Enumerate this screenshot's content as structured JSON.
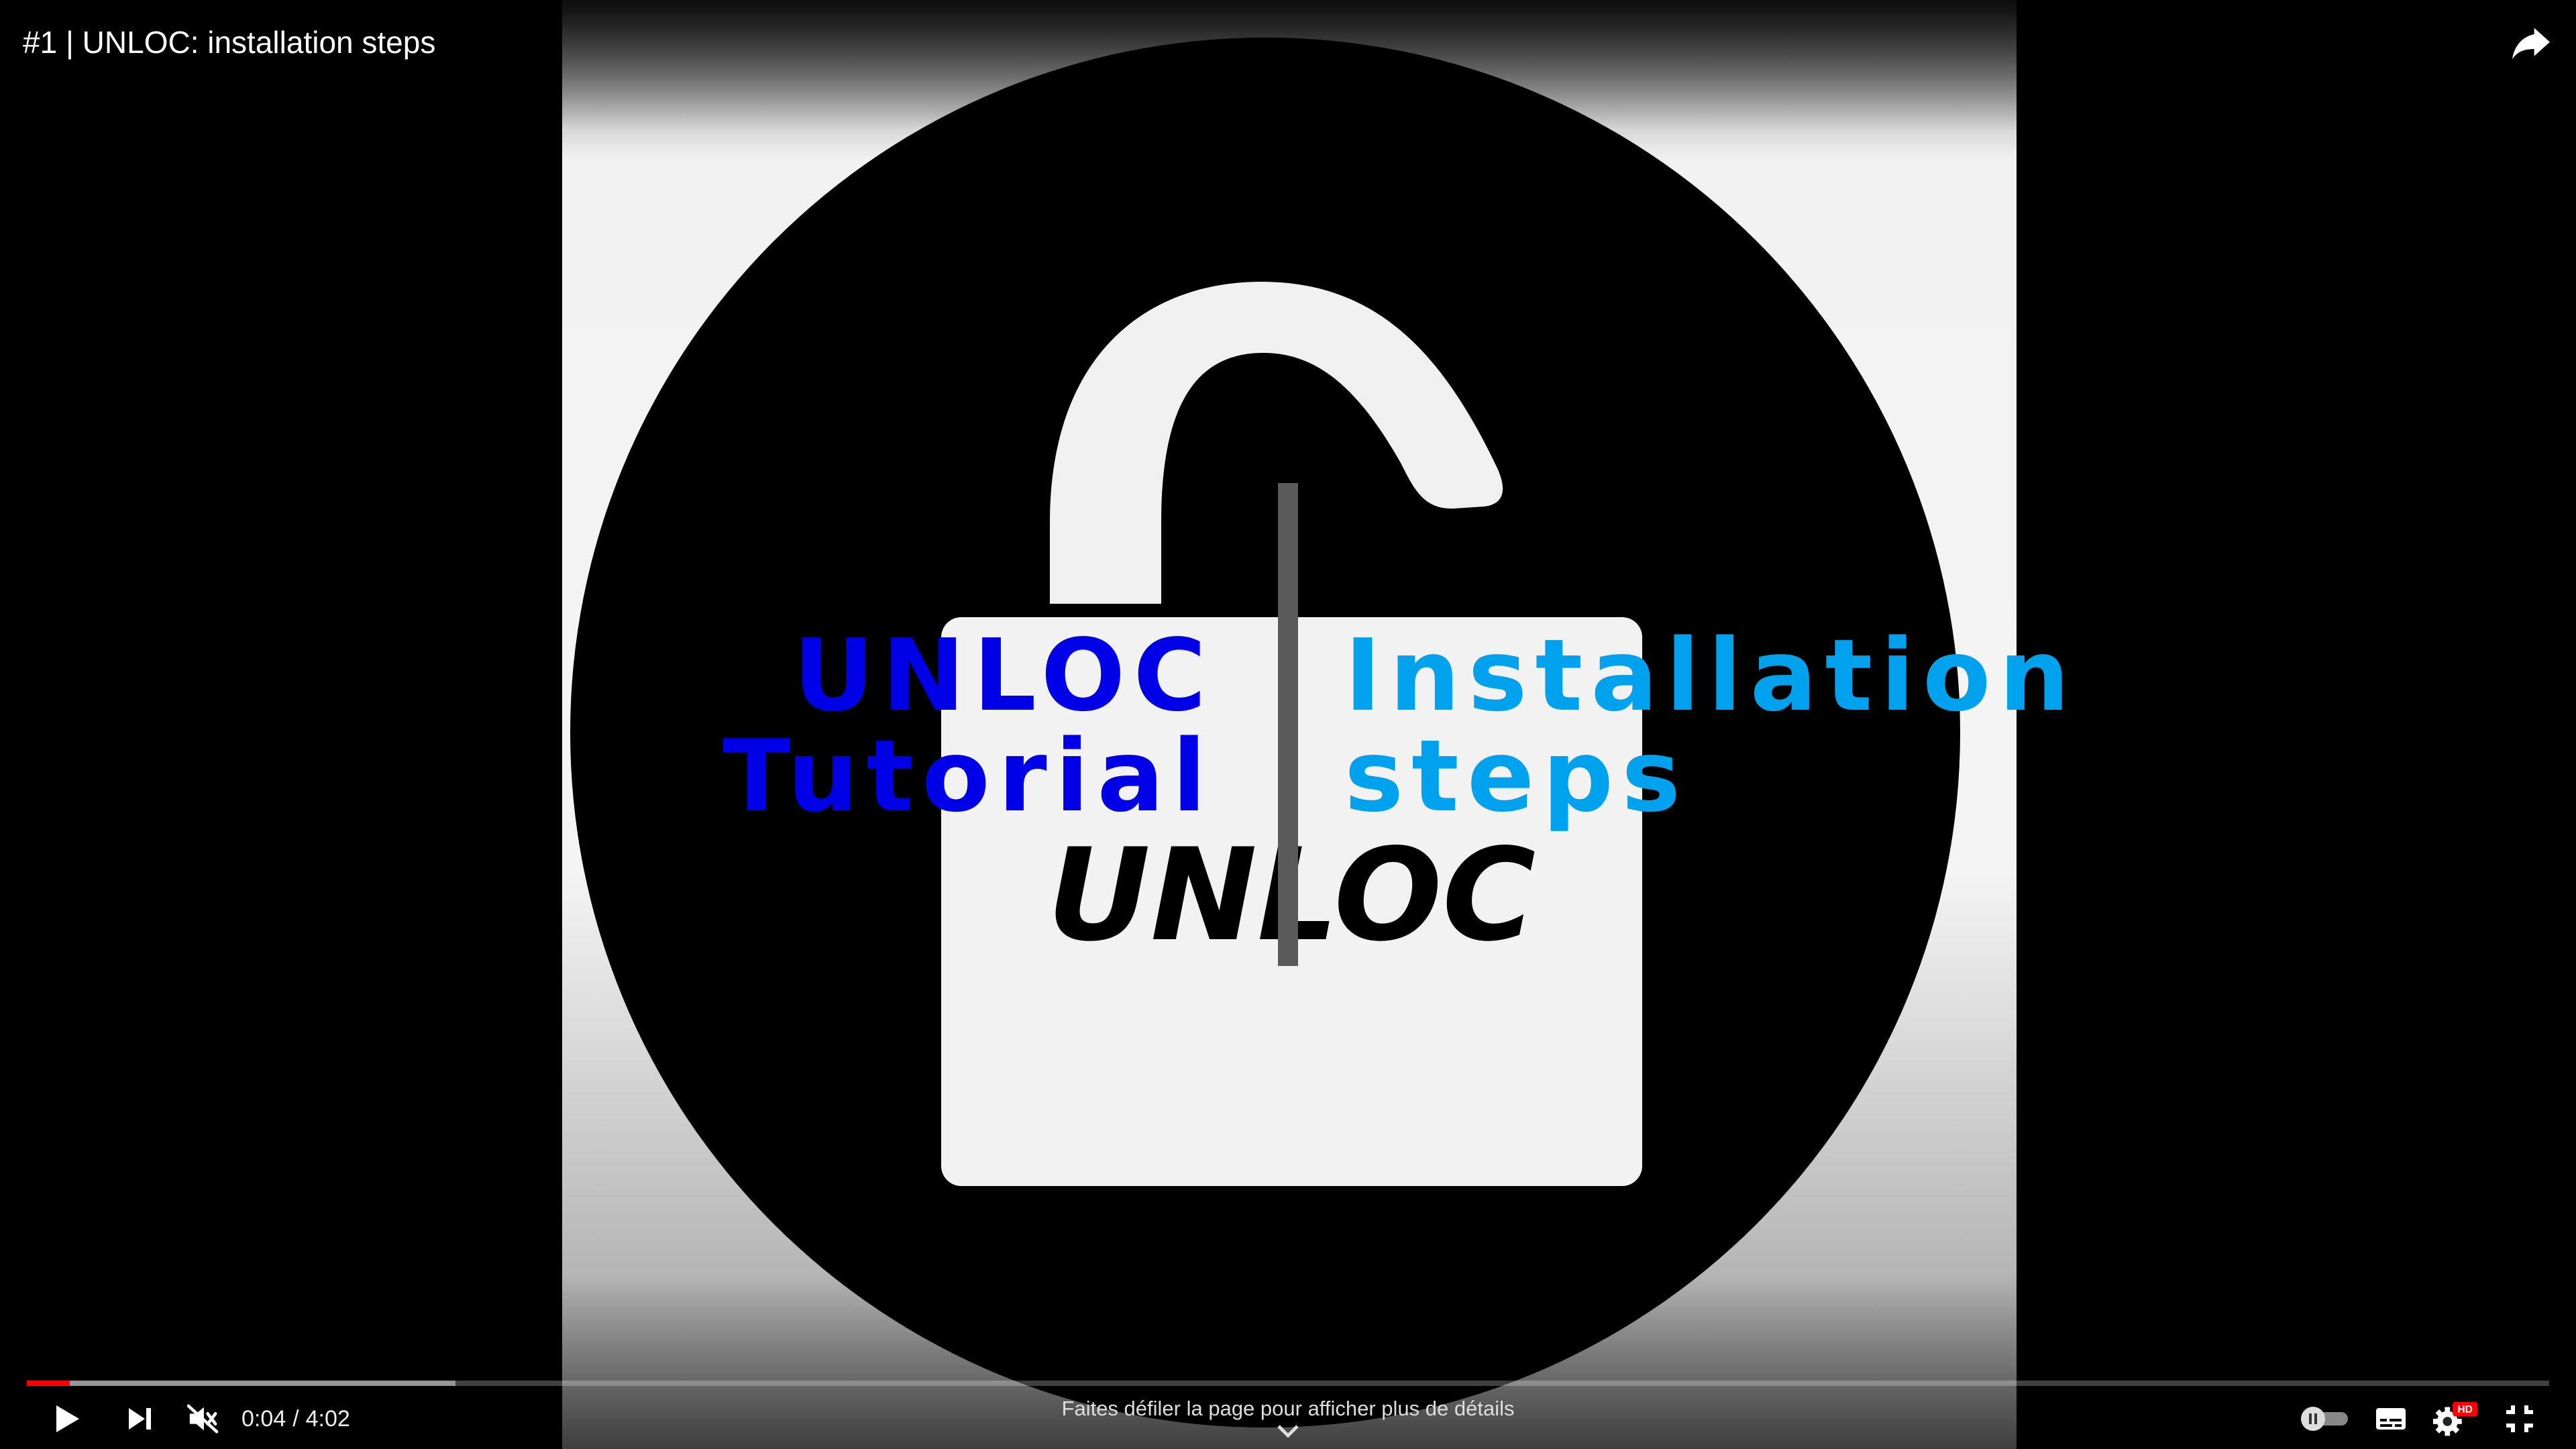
{
  "video": {
    "title": "#1 | UNLOC: installation steps"
  },
  "overlay": {
    "left_line1": "UNLOC",
    "left_line2": "Tutorial",
    "right_line1": "Installation",
    "right_line2": "steps",
    "left_color": "#0000e6",
    "right_color": "#00a2ee"
  },
  "logo": {
    "text": "UNLOC"
  },
  "player": {
    "current_time": "0:04",
    "time_separator": "/",
    "duration": "4:02",
    "played_fraction": 0.017,
    "loaded_fraction": 0.17,
    "scroll_hint": "Faites défiler la page pour afficher plus de détails",
    "quality_badge": "HD",
    "accent_color": "#ff0000"
  },
  "icons": {
    "play": "play-icon",
    "next": "next-icon",
    "mute": "volume-muted-icon",
    "autoplay": "autoplay-toggle-icon",
    "subtitles": "subtitles-icon",
    "settings": "gear-icon",
    "fullscreen_exit": "exit-fullscreen-icon",
    "share": "share-icon"
  }
}
